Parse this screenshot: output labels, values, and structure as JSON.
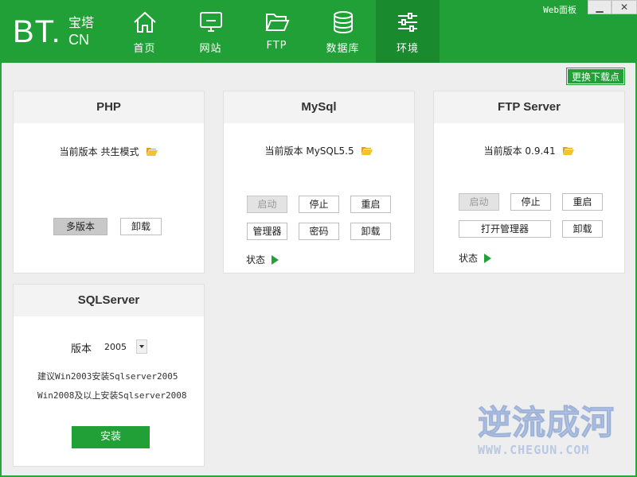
{
  "logo": {
    "bt": "BT.",
    "cn_top": "宝塔",
    "cn_bottom": "CN"
  },
  "nav": [
    {
      "label": "首页",
      "icon": "home-icon"
    },
    {
      "label": "网站",
      "icon": "monitor-icon"
    },
    {
      "label": "FTP",
      "icon": "folder-icon"
    },
    {
      "label": "数据库",
      "icon": "database-icon"
    },
    {
      "label": "环境",
      "icon": "sliders-icon",
      "active": true
    }
  ],
  "titlebar": {
    "web_panel": "Web面板",
    "minimize": "▁",
    "close": "✕"
  },
  "toolbar": {
    "mirror_label": "更换下载点"
  },
  "php": {
    "title": "PHP",
    "version": "当前版本 共生模式",
    "multi_version": "多版本",
    "uninstall": "卸载"
  },
  "mysql": {
    "title": "MySql",
    "version": "当前版本 MySQL5.5",
    "start": "启动",
    "stop": "停止",
    "restart": "重启",
    "manager": "管理器",
    "password": "密码",
    "uninstall": "卸载",
    "status": "状态"
  },
  "ftp": {
    "title": "FTP Server",
    "version": "当前版本 0.9.41",
    "start": "启动",
    "stop": "停止",
    "restart": "重启",
    "open_manager": "打开管理器",
    "uninstall": "卸载",
    "status": "状态"
  },
  "sqlserver": {
    "title": "SQLServer",
    "version_label": "版本",
    "version_value": "2005",
    "note1": "建议Win2003安装Sqlserver2005",
    "note2": "Win2008及以上安装Sqlserver2008",
    "install": "安装"
  },
  "watermark": {
    "cn": "逆流成河",
    "en": "WWW.CHEGUN.COM"
  },
  "colors": {
    "brand_green": "#21a037",
    "active_nav": "#1a8a2e",
    "folder_yellow": "#e8b923"
  }
}
